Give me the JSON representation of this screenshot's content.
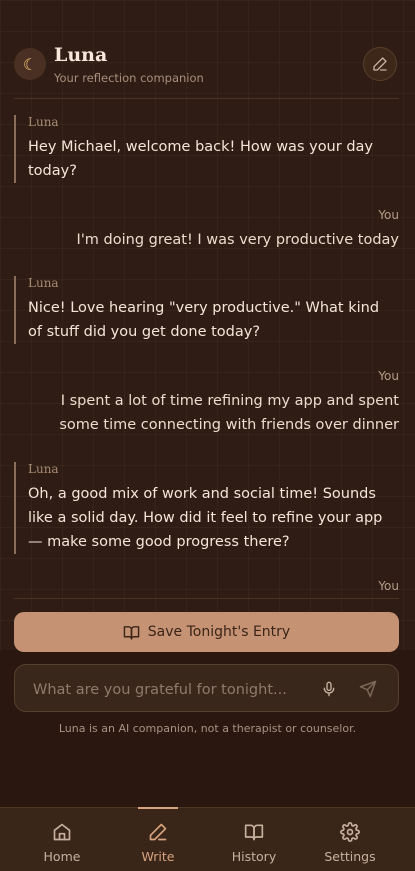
{
  "header": {
    "title": "Luna",
    "subtitle": "Your reflection companion",
    "avatar_icon": "moon-icon",
    "edit_icon": "pencil-icon"
  },
  "messages": [
    {
      "sender": "Luna",
      "text": [
        "Hey Michael, welcome back! How was your day",
        "today?"
      ]
    },
    {
      "sender": "You",
      "text": [
        "I'm doing great! I was very productive today"
      ]
    },
    {
      "sender": "Luna",
      "text": [
        "Nice! Love hearing \"very productive.\" What kind",
        "of stuff did you get done today?"
      ]
    },
    {
      "sender": "You",
      "text": [
        "I spent a lot of time refining my app and spent",
        "some time connecting with friends over dinner"
      ]
    },
    {
      "sender": "Luna",
      "text": [
        "Oh, a good mix of work and social time! Sounds",
        "like a solid day. How did it feel to refine your app",
        "— make some good progress there?"
      ]
    },
    {
      "sender": "You",
      "text": []
    }
  ],
  "save_button": {
    "label": "Save Tonight's Entry",
    "icon": "book-icon"
  },
  "input": {
    "placeholder": "What are you grateful for tonight...",
    "value": ""
  },
  "disclaimer": "Luna is an AI companion, not a therapist or counselor.",
  "nav": [
    {
      "label": "Home",
      "icon": "home-icon",
      "active": false
    },
    {
      "label": "Write",
      "icon": "pencil-icon",
      "active": true
    },
    {
      "label": "History",
      "icon": "book-icon",
      "active": false
    },
    {
      "label": "Settings",
      "icon": "gear-icon",
      "active": false
    }
  ],
  "colors": {
    "accent": "#c59374",
    "background": "#2f1c14",
    "active_nav": "#d7a47f"
  }
}
